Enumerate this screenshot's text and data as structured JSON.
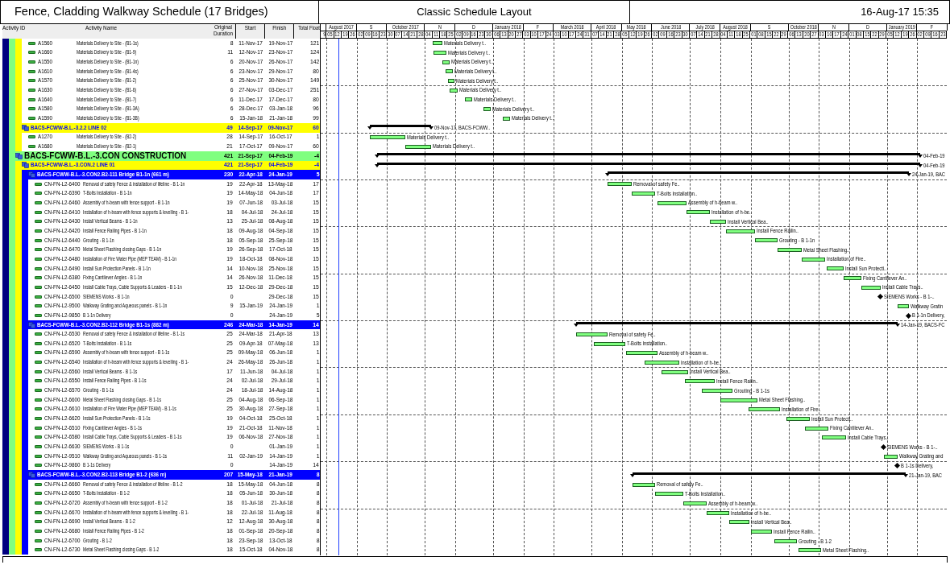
{
  "header": {
    "title": "Fence, Cladding Walkway Schedule (17 Bridges)",
    "layout": "Classic Schedule Layout",
    "date": "16-Aug-17 15:35"
  },
  "columns": [
    "Activity ID",
    "Activity Name",
    "Original Duration",
    "Start",
    "Finish",
    "Total Float"
  ],
  "timeline": {
    "lead_day": "9",
    "months": [
      {
        "label": "August 2017",
        "days": [
          "05",
          "12",
          "19",
          "26"
        ]
      },
      {
        "label": "S",
        "days": [
          "02",
          "09",
          "16",
          "23"
        ]
      },
      {
        "label": "October 2017",
        "days": [
          "30",
          "07",
          "14",
          "21",
          "28"
        ]
      },
      {
        "label": "N",
        "days": [
          "04",
          "11",
          "18",
          "25"
        ]
      },
      {
        "label": "D",
        "days": [
          "02",
          "09",
          "16",
          "23",
          "30"
        ]
      },
      {
        "label": "January 2018",
        "days": [
          "06",
          "13",
          "20",
          "27"
        ]
      },
      {
        "label": "F",
        "days": [
          "03",
          "10",
          "17",
          "24"
        ]
      },
      {
        "label": "March 2018",
        "days": [
          "03",
          "10",
          "17",
          "24",
          "31"
        ]
      },
      {
        "label": "April 2018",
        "days": [
          "07",
          "14",
          "21",
          "28"
        ]
      },
      {
        "label": "May 2018",
        "days": [
          "05",
          "12",
          "19",
          "26"
        ]
      },
      {
        "label": "June 2018",
        "days": [
          "02",
          "09",
          "16",
          "23",
          "30"
        ]
      },
      {
        "label": "July 2018",
        "days": [
          "07",
          "14",
          "21",
          "28"
        ]
      },
      {
        "label": "August 2018",
        "days": [
          "04",
          "11",
          "18",
          "25"
        ]
      },
      {
        "label": "S",
        "days": [
          "01",
          "08",
          "15",
          "22",
          "29"
        ]
      },
      {
        "label": "October 2018",
        "days": [
          "06",
          "13",
          "20",
          "27"
        ]
      },
      {
        "label": "N",
        "days": [
          "03",
          "10",
          "17",
          "24"
        ]
      },
      {
        "label": "D",
        "days": [
          "01",
          "08",
          "15",
          "22",
          "29"
        ]
      },
      {
        "label": "January 2019",
        "days": [
          "05",
          "12",
          "19",
          "26"
        ]
      },
      {
        "label": "F",
        "days": [
          "02",
          "09",
          "16",
          "23"
        ]
      }
    ]
  },
  "rows": [
    {
      "kind": "continued",
      "children": [
        {
          "kind": "continued",
          "children": [
            {
              "kind": "continued",
              "children": [
                {
                  "kind": "activity",
                  "id": "A1560",
                  "name": "Materials Delivery to Site - (B1-1s)",
                  "duration": "8",
                  "start": "11-Nov-17",
                  "finish": "19-Nov-17",
                  "float": "121",
                  "bar_label": "Materials Delivery t.."
                },
                {
                  "kind": "activity",
                  "id": "A1660",
                  "name": "Materials Delivery to Site - (B1-9)",
                  "duration": "11",
                  "start": "12-Nov-17",
                  "finish": "23-Nov-17",
                  "float": "124",
                  "bar_label": "Materials Delivery t.."
                },
                {
                  "kind": "activity",
                  "id": "A1550",
                  "name": "Materials Delivery to Site - (B1-1n)",
                  "duration": "6",
                  "start": "20-Nov-17",
                  "finish": "26-Nov-17",
                  "float": "142",
                  "bar_label": "Materials Delivery t.."
                },
                {
                  "kind": "activity",
                  "id": "A1610",
                  "name": "Materials Delivery to Site - (B1-4s)",
                  "duration": "6",
                  "start": "23-Nov-17",
                  "finish": "29-Nov-17",
                  "float": "80",
                  "bar_label": "Materials Delivery t.."
                },
                {
                  "kind": "activity",
                  "id": "A1570",
                  "name": "Materials Delivery to Site - (B1-2)",
                  "duration": "6",
                  "start": "25-Nov-17",
                  "finish": "30-Nov-17",
                  "float": "149",
                  "bar_label": "Materials Delivery t.."
                },
                {
                  "kind": "activity",
                  "id": "A1630",
                  "name": "Materials Delivery to Site - (B1-6)",
                  "duration": "6",
                  "start": "27-Nov-17",
                  "finish": "03-Dec-17",
                  "float": "251",
                  "bar_label": "Materials Delivery t.."
                },
                {
                  "kind": "activity",
                  "id": "A1640",
                  "name": "Materials Delivery to Site - (B1-7)",
                  "duration": "6",
                  "start": "11-Dec-17",
                  "finish": "17-Dec-17",
                  "float": "80",
                  "bar_label": "Materials Delivery t.."
                },
                {
                  "kind": "activity",
                  "id": "A1580",
                  "name": "Materials Delivery to Site - (B1-3A)",
                  "duration": "6",
                  "start": "28-Dec-17",
                  "finish": "03-Jan-18",
                  "float": "96",
                  "bar_label": "Materials Delivery t.."
                },
                {
                  "kind": "activity",
                  "id": "A1590",
                  "name": "Materials Delivery to Site - (B1-3B)",
                  "duration": "6",
                  "start": "15-Jan-18",
                  "finish": "21-Jan-18",
                  "float": "99",
                  "bar_label": "Materials Delivery t.."
                }
              ]
            },
            {
              "kind": "wbs",
              "name": "BACS-FCWW-B.L.-3.2.2 LINE 02",
              "duration": "49",
              "start": "14-Sep-17",
              "finish": "09-Nov-17",
              "float": "60",
              "bar_label": "09-Nov-17, BACS-FCWW..",
              "children": [
                {
                  "kind": "activity",
                  "id": "A1270",
                  "name": "Materials Delivery to Site - (B2-2)",
                  "duration": "28",
                  "start": "14-Sep-17",
                  "finish": "16-Oct-17",
                  "float": "1",
                  "bar_label": "Materials Delivery t.."
                },
                {
                  "kind": "activity",
                  "id": "A1680",
                  "name": "Materials Delivery to Site - (B2-1)",
                  "duration": "21",
                  "start": "17-Oct-17",
                  "finish": "09-Nov-17",
                  "float": "60",
                  "bar_label": "Materials Delivery t.."
                }
              ]
            }
          ]
        },
        {
          "kind": "wbs",
          "name": "BACS-FCWW-B.L.-3.CON CONSTRUCTION",
          "duration": "421",
          "start": "21-Sep-17",
          "finish": "04-Feb-19",
          "float": "-4",
          "bar_label": "04-Feb-19",
          "children": [
            {
              "kind": "wbs",
              "name": "BACS-FCWW-B.L.-3.CON.2 LINE 01",
              "duration": "421",
              "start": "21-Sep-17",
              "finish": "04-Feb-19",
              "float": "-4",
              "bar_label": "04-Feb-19",
              "children": [
                {
                  "kind": "wbs",
                  "name": "BACS-FCWW-B.L.-3.CON2.B2-111 Bridge B1-1n (661 m)",
                  "duration": "230",
                  "start": "22-Apr-18",
                  "finish": "24-Jan-19",
                  "float": "5",
                  "bar_label": "24-Jan-19, BAC",
                  "children": [
                    {
                      "kind": "activity",
                      "id": "CN-FN-L2-6400",
                      "name": "Removal of safety Fence & installation of lifeline - B 1-1n",
                      "duration": "19",
                      "start": "22-Apr-18",
                      "finish": "13-May-18",
                      "float": "17",
                      "bar_label": "Removal of safety Fe.."
                    },
                    {
                      "kind": "activity",
                      "id": "CN-FN-L2-6390",
                      "name": "T-Bolts Installation - B 1-1n",
                      "duration": "19",
                      "start": "14-May-18",
                      "finish": "04-Jun-18",
                      "float": "17",
                      "bar_label": "T-Bolts Installation.."
                    },
                    {
                      "kind": "activity",
                      "id": "CN-FN-L2-6460",
                      "name": "Assembly of h-beam with fence support - B 1-1n",
                      "duration": "19",
                      "start": "07-Jun-18",
                      "finish": "03-Jul-18",
                      "float": "15",
                      "bar_label": "Assembly of h-beam w.."
                    },
                    {
                      "kind": "activity",
                      "id": "CN-FN-L2-6410",
                      "name": "Installation of h-beam with fence supports & levelling - B 1-",
                      "duration": "18",
                      "start": "04-Jul-18",
                      "finish": "24-Jul-18",
                      "float": "15",
                      "bar_label": "Installation of h-be.."
                    },
                    {
                      "kind": "activity",
                      "id": "CN-FN-L2-6430",
                      "name": "Install Vertical Beams - B 1-1n",
                      "duration": "13",
                      "start": "25-Jul-18",
                      "finish": "08-Aug-18",
                      "float": "15",
                      "bar_label": "Install Vertical Bea.."
                    },
                    {
                      "kind": "activity",
                      "id": "CN-FN-L2-6420",
                      "name": "Install Fence Railing Pipes - B 1-1n",
                      "duration": "18",
                      "start": "09-Aug-18",
                      "finish": "04-Sep-18",
                      "float": "15",
                      "bar_label": "Install Fence Railin.."
                    },
                    {
                      "kind": "activity",
                      "id": "CN-FN-L2-6440",
                      "name": "Grouting - B 1-1n",
                      "duration": "18",
                      "start": "05-Sep-18",
                      "finish": "25-Sep-18",
                      "float": "15",
                      "bar_label": "Grouting - B 1-1n"
                    },
                    {
                      "kind": "activity",
                      "id": "CN-FN-L2-6470",
                      "name": "Metal Sheet Flashing closing Gaps - B 1-1n",
                      "duration": "19",
                      "start": "26-Sep-18",
                      "finish": "17-Oct-18",
                      "float": "15",
                      "bar_label": "Metal Sheet Flashing.."
                    },
                    {
                      "kind": "activity",
                      "id": "CN-FN-L2-6480",
                      "name": "Installation of Fire Water Pipe (MEP TEAM) - B 1-1n",
                      "duration": "19",
                      "start": "18-Oct-18",
                      "finish": "08-Nov-18",
                      "float": "15",
                      "bar_label": "Installation of Fire.."
                    },
                    {
                      "kind": "activity",
                      "id": "CN-FN-L2-6490",
                      "name": "Install Sun Protection Panels - B 1-1n",
                      "duration": "14",
                      "start": "10-Nov-18",
                      "finish": "25-Nov-18",
                      "float": "15",
                      "bar_label": "Install Sun Protecti.."
                    },
                    {
                      "kind": "activity",
                      "id": "CN-FN-L2-6380",
                      "name": "Fixing Cantilever Angles - B 1-1n",
                      "duration": "14",
                      "start": "26-Nov-18",
                      "finish": "11-Dec-18",
                      "float": "15",
                      "bar_label": "Fixing Cantilever An.."
                    },
                    {
                      "kind": "activity",
                      "id": "CN-FN-L2-6450",
                      "name": "Install Cable Trays, Cable Supports & Leaders - B 1-1n",
                      "duration": "15",
                      "start": "12-Dec-18",
                      "finish": "29-Dec-18",
                      "float": "15",
                      "bar_label": "Install Cable Trays.."
                    },
                    {
                      "kind": "milestone",
                      "id": "CN-FN-L2-6500",
                      "name": "SIEMENS Works - B 1-1n",
                      "duration": "0",
                      "finish": "29-Dec-18",
                      "float": "15",
                      "bar_label": "SIEMENS Works - B 1-.."
                    },
                    {
                      "kind": "activity",
                      "id": "CN-FN-L2-9500",
                      "name": "Walkway Grating and Aqueous panels - B 1-1n",
                      "duration": "9",
                      "start": "15-Jan-19",
                      "finish": "24-Jan-19",
                      "float": "1",
                      "bar_label": "Walkway Gratin"
                    },
                    {
                      "kind": "milestone",
                      "id": "CN-FN-L2-9850",
                      "name": "B 1-1n Delivery",
                      "duration": "0",
                      "finish": "24-Jan-19",
                      "float": "5",
                      "bar_label": "B 1-1n Delivery,"
                    }
                  ]
                },
                {
                  "kind": "wbs",
                  "name": "BACS-FCWW-B.L.-3.CON2.B2-112 Bridge B1-1s (882 m)",
                  "duration": "246",
                  "start": "24-Mar-18",
                  "finish": "14-Jan-19",
                  "float": "14",
                  "bar_label": "14-Jan-19, BACS-FC",
                  "children": [
                    {
                      "kind": "activity",
                      "id": "CN-FN-L2-6530",
                      "name": "Removal of safety Fence & installation of lifeline - B 1-1s",
                      "duration": "25",
                      "start": "24-Mar-18",
                      "finish": "21-Apr-18",
                      "float": "13",
                      "bar_label": "Removal of safety Fe.."
                    },
                    {
                      "kind": "activity",
                      "id": "CN-FN-L2-6520",
                      "name": "T-Bolts Installation - B 1-1s",
                      "duration": "25",
                      "start": "09-Apr-18",
                      "finish": "07-May-18",
                      "float": "13",
                      "bar_label": "T-Bolts Installation.."
                    },
                    {
                      "kind": "activity",
                      "id": "CN-FN-L2-6590",
                      "name": "Assembly of h-beam with fence support - B 1-1s",
                      "duration": "25",
                      "start": "09-May-18",
                      "finish": "06-Jun-18",
                      "float": "1",
                      "bar_label": "Assembly of h-beam w.."
                    },
                    {
                      "kind": "activity",
                      "id": "CN-FN-L2-6540",
                      "name": "Installation of h-beam with fence supports & levelling - B 1-",
                      "duration": "24",
                      "start": "26-May-18",
                      "finish": "26-Jun-18",
                      "float": "1",
                      "bar_label": "Installation of h-be.."
                    },
                    {
                      "kind": "activity",
                      "id": "CN-FN-L2-6560",
                      "name": "Install Vertical Beams - B 1-1s",
                      "duration": "17",
                      "start": "11-Jun-18",
                      "finish": "04-Jul-18",
                      "float": "1",
                      "bar_label": "Install Vertical Bea.."
                    },
                    {
                      "kind": "activity",
                      "id": "CN-FN-L2-6550",
                      "name": "Install Fence Railing Pipes - B 1-1s",
                      "duration": "24",
                      "start": "02-Jul-18",
                      "finish": "29-Jul-18",
                      "float": "1",
                      "bar_label": "Install Fence Railin.."
                    },
                    {
                      "kind": "activity",
                      "id": "CN-FN-L2-6570",
                      "name": "Grouting - B 1-1s",
                      "duration": "24",
                      "start": "18-Jul-18",
                      "finish": "14-Aug-18",
                      "float": "1",
                      "bar_label": "Grouting - B 1-1s"
                    },
                    {
                      "kind": "activity",
                      "id": "CN-FN-L2-6600",
                      "name": "Metal Sheet Flashing closing Gaps - B 1-1s",
                      "duration": "25",
                      "start": "04-Aug-18",
                      "finish": "06-Sep-18",
                      "float": "1",
                      "bar_label": "Metal Sheet Flashing.."
                    },
                    {
                      "kind": "activity",
                      "id": "CN-FN-L2-6610",
                      "name": "Installation of Fire Water Pipe (MEP TEAM) - B 1-1s",
                      "duration": "25",
                      "start": "30-Aug-18",
                      "finish": "27-Sep-18",
                      "float": "1",
                      "bar_label": "Installation of Fire.."
                    },
                    {
                      "kind": "activity",
                      "id": "CN-FN-L2-6620",
                      "name": "Install Sun Protection Panels - B 1-1s",
                      "duration": "19",
                      "start": "04-Oct-18",
                      "finish": "25-Oct-18",
                      "float": "1",
                      "bar_label": "Install Sun Protecti.."
                    },
                    {
                      "kind": "activity",
                      "id": "CN-FN-L2-6510",
                      "name": "Fixing Cantilever Angles - B 1-1s",
                      "duration": "19",
                      "start": "21-Oct-18",
                      "finish": "11-Nov-18",
                      "float": "1",
                      "bar_label": "Fixing Cantilever An.."
                    },
                    {
                      "kind": "activity",
                      "id": "CN-FN-L2-6580",
                      "name": "Install Cable Trays, Cable Supports & Leaders - B 1-1s",
                      "duration": "19",
                      "start": "06-Nov-18",
                      "finish": "27-Nov-18",
                      "float": "1",
                      "bar_label": "Install Cable Trays.."
                    },
                    {
                      "kind": "milestone",
                      "id": "CN-FN-L2-6630",
                      "name": "SIEMENS Works - B 1-1s",
                      "duration": "0",
                      "finish": "01-Jan-19",
                      "float": "1",
                      "bar_label": "SIEMENS Works - B 1-.."
                    },
                    {
                      "kind": "activity",
                      "id": "CN-FN-L2-9510",
                      "name": "Walkway Grating and Aqueous panels - B 1-1s",
                      "duration": "11",
                      "start": "02-Jan-19",
                      "finish": "14-Jan-19",
                      "float": "1",
                      "bar_label": "Walkway Grating and"
                    },
                    {
                      "kind": "milestone",
                      "id": "CN-FN-L2-9860",
                      "name": "B 1-1s Delivery",
                      "duration": "0",
                      "finish": "14-Jan-19",
                      "float": "14",
                      "bar_label": "B 1-1s Delivery,"
                    }
                  ]
                },
                {
                  "kind": "wbs",
                  "name": "BACS-FCWW-B.L.-3.CON2.B2-113 Bridge B1-2 (636 m)",
                  "duration": "207",
                  "start": "15-May-18",
                  "finish": "21-Jan-19",
                  "float": "8",
                  "bar_label": "21-Jan-19, BAC",
                  "children": [
                    {
                      "kind": "activity",
                      "id": "CN-FN-L2-6660",
                      "name": "Removal of safety Fence & installation of lifeline - B 1-2",
                      "duration": "18",
                      "start": "15-May-18",
                      "finish": "04-Jun-18",
                      "float": "8",
                      "bar_label": "Removal of safety Fe.."
                    },
                    {
                      "kind": "activity",
                      "id": "CN-FN-L2-6650",
                      "name": "T-Bolts Installation - B 1-2",
                      "duration": "18",
                      "start": "05-Jun-18",
                      "finish": "30-Jun-18",
                      "float": "8",
                      "bar_label": "T-Bolts Installation.."
                    },
                    {
                      "kind": "activity",
                      "id": "CN-FN-L2-6720",
                      "name": "Assembly of h-beam with fence support - B 1-2",
                      "duration": "18",
                      "start": "01-Jul-18",
                      "finish": "21-Jul-18",
                      "float": "8",
                      "bar_label": "Assembly of h-beam w.."
                    },
                    {
                      "kind": "activity",
                      "id": "CN-FN-L2-6670",
                      "name": "Installation of h-beam with fence supports & levelling - B 1-",
                      "duration": "18",
                      "start": "22-Jul-18",
                      "finish": "11-Aug-18",
                      "float": "8",
                      "bar_label": "Installation of h-be.."
                    },
                    {
                      "kind": "activity",
                      "id": "CN-FN-L2-6690",
                      "name": "Install Vertical Beams - B 1-2",
                      "duration": "12",
                      "start": "12-Aug-18",
                      "finish": "30-Aug-18",
                      "float": "8",
                      "bar_label": "Install Vertical Bea.."
                    },
                    {
                      "kind": "activity",
                      "id": "CN-FN-L2-6680",
                      "name": "Install Fence Railing Pipes - B 1-2",
                      "duration": "18",
                      "start": "01-Sep-18",
                      "finish": "20-Sep-18",
                      "float": "8",
                      "bar_label": "Install Fence Railin.."
                    },
                    {
                      "kind": "activity",
                      "id": "CN-FN-L2-6700",
                      "name": "Grouting - B 1-2",
                      "duration": "18",
                      "start": "23-Sep-18",
                      "finish": "13-Oct-18",
                      "float": "8",
                      "bar_label": "Grouting - B 1-2"
                    },
                    {
                      "kind": "activity",
                      "id": "CN-FN-L2-6730",
                      "name": "Metal Sheet Flashing closing Gaps - B 1-2",
                      "duration": "18",
                      "start": "15-Oct-18",
                      "finish": "04-Nov-18",
                      "float": "8",
                      "bar_label": "Metal Sheet Flashing.."
                    }
                  ]
                }
              ]
            }
          ]
        }
      ]
    }
  ]
}
